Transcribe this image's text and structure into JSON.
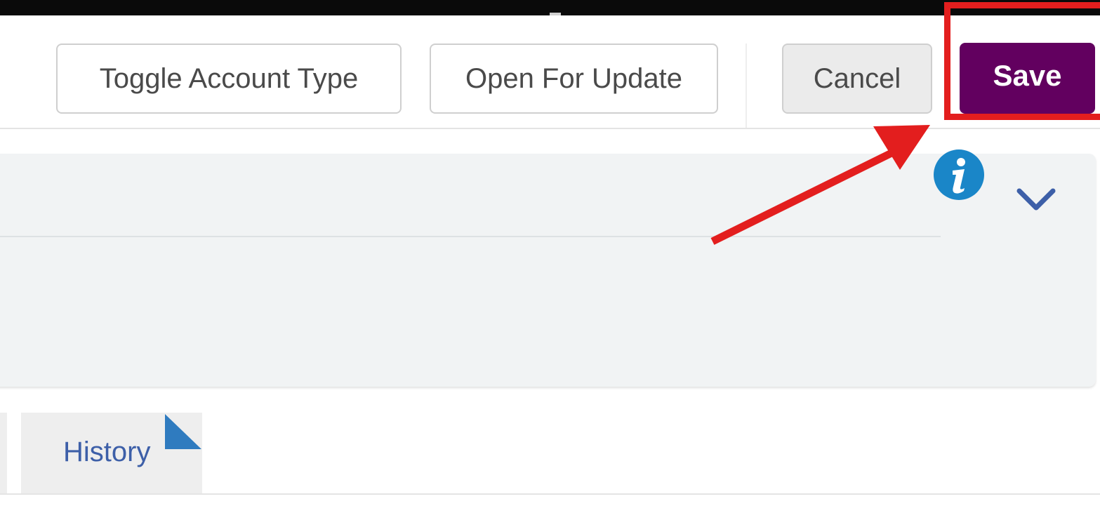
{
  "toolbar": {
    "toggle_account_type_label": "Toggle Account Type",
    "open_for_update_label": "Open For Update",
    "cancel_label": "Cancel",
    "save_label": "Save"
  },
  "colors": {
    "save_bg": "#62005f",
    "highlight": "#e31e1e",
    "info_icon": "#1a86c8",
    "chevron": "#3d5fa8",
    "tab_text": "#3d5fa8"
  },
  "icons": {
    "info": "info-icon",
    "expand": "chevron-down-icon",
    "annotation": "red-arrow"
  },
  "tabs": [
    {
      "label": "History"
    }
  ]
}
